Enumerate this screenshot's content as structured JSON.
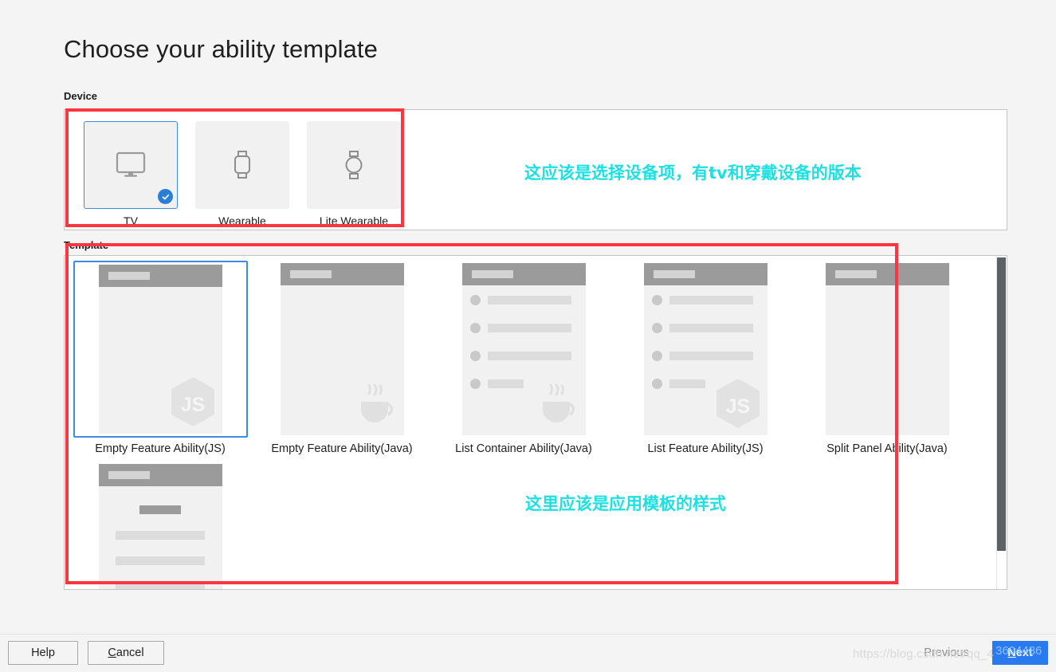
{
  "page": {
    "title": "Choose your ability template"
  },
  "device_section": {
    "label": "Device",
    "items": [
      {
        "name": "TV",
        "icon": "tv-monitor-icon",
        "selected": true
      },
      {
        "name": "Wearable",
        "icon": "square-smartwatch-icon",
        "selected": false
      },
      {
        "name": "Lite Wearable",
        "icon": "round-smartwatch-icon",
        "selected": false
      }
    ]
  },
  "template_section": {
    "label": "Template",
    "items": [
      {
        "name": "Empty Feature Ability(JS)",
        "logo": "js-hexagon-icon",
        "layout": "empty",
        "selected": true
      },
      {
        "name": "Empty Feature Ability(Java)",
        "logo": "java-coffee-cup-icon",
        "layout": "empty",
        "selected": false
      },
      {
        "name": "List Container Ability(Java)",
        "logo": "java-coffee-cup-icon",
        "layout": "list",
        "selected": false
      },
      {
        "name": "List Feature Ability(JS)",
        "logo": "js-hexagon-icon",
        "layout": "list",
        "selected": false
      },
      {
        "name": "Split Panel Ability(Java)",
        "logo": "none",
        "layout": "empty",
        "selected": false
      },
      {
        "name": "",
        "logo": "none",
        "layout": "centered",
        "selected": false
      }
    ]
  },
  "annotations": [
    {
      "text": "这应该是选择设备项，有tv和穿戴设备的版本",
      "color": "#1fe0e0",
      "target": "device-section"
    },
    {
      "text": "这里应该是应用模板的样式",
      "color": "#1fe0e0",
      "target": "template-section"
    }
  ],
  "footer": {
    "help": "Help",
    "cancel_prefix": "",
    "cancel_mnemonic": "C",
    "cancel_suffix": "ancel",
    "previous": "Previous",
    "next_mnemonic": "N",
    "next_prefix": "",
    "next_suffix": "ext"
  },
  "watermark": {
    "url": "https://blog.csdn.net/qq_4",
    "highlight": "3604486"
  },
  "colors": {
    "accent_blue": "#2979ef",
    "selection_border": "#3d8ce0",
    "annotation_red": "#fb3640",
    "annotation_cyan": "#1fe0e0",
    "mock_header_gray": "#9b9b9b",
    "mock_body_gray": "#f1f1f1"
  }
}
